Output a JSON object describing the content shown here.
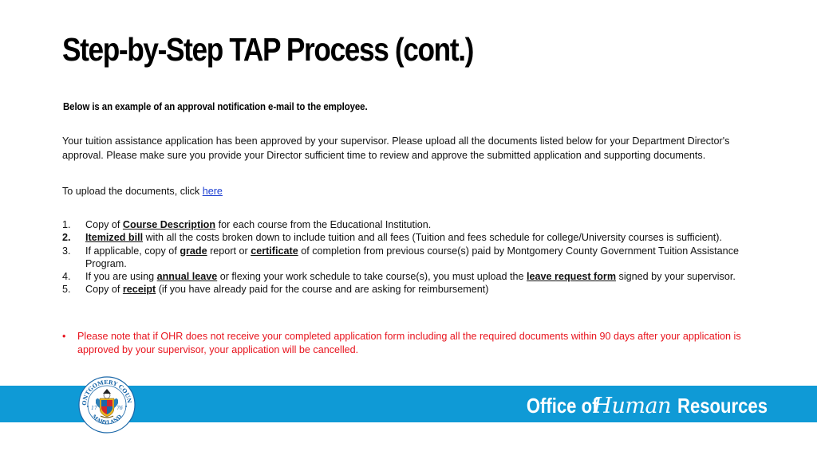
{
  "slide": {
    "title": "Step-by-Step TAP Process (cont.)",
    "subtitle": "Below is an example of an approval notification e-mail to the employee."
  },
  "email": {
    "paragraph1": "Your tuition assistance application has been approved by your supervisor. Please upload all the documents listed below for your Department Director's approval. Please make sure you provide your Director sufficient time to review and approve the submitted application and supporting documents.",
    "upload_prefix": "To upload the documents, click ",
    "upload_link": "here",
    "items": [
      {
        "num": "1.",
        "pre": "Copy of ",
        "kw1": "Course Description",
        "mid": " for each course from the Educational Institution.",
        "kw2": "",
        "post": ""
      },
      {
        "num": "2.",
        "pre": "",
        "kw1": "Itemized bill",
        "mid": " with all the costs broken down to include tuition and all fees (Tuition and fees schedule for college/University courses is sufficient).",
        "kw2": "",
        "post": ""
      },
      {
        "num": "3.",
        "pre": "If applicable, copy of ",
        "kw1": "grade",
        "mid": " report or ",
        "kw2": "certificate",
        "post": " of completion from previous course(s) paid by Montgomery County Government Tuition Assistance Program."
      },
      {
        "num": "4.",
        "pre": "If you are using ",
        "kw1": "annual leave",
        "mid": " or flexing your work schedule to take course(s), you must upload the ",
        "kw2": "leave request form",
        "post": " signed by your supervisor."
      },
      {
        "num": "5.",
        "pre": "Copy of ",
        "kw1": "receipt",
        "mid": " (if you have already paid for the course and are asking for reimbursement)",
        "kw2": "",
        "post": ""
      }
    ],
    "note_bullet": "•",
    "note": "Please note that if OHR does not receive your completed application form including all the required documents within 90 days after your application is approved by your supervisor, your application will be cancelled."
  },
  "footer": {
    "seal": {
      "top_text": "MONTGOMERY COUNTY",
      "bottom_text": "MARYLAND",
      "year_left": "17",
      "year_right": "76"
    },
    "brand": {
      "office": "Office of",
      "human": "Human",
      "resources": "Resources"
    },
    "colors": {
      "banner": "#0f9ad6",
      "note_red": "#e8141e",
      "link_blue": "#1c3ed1"
    }
  }
}
